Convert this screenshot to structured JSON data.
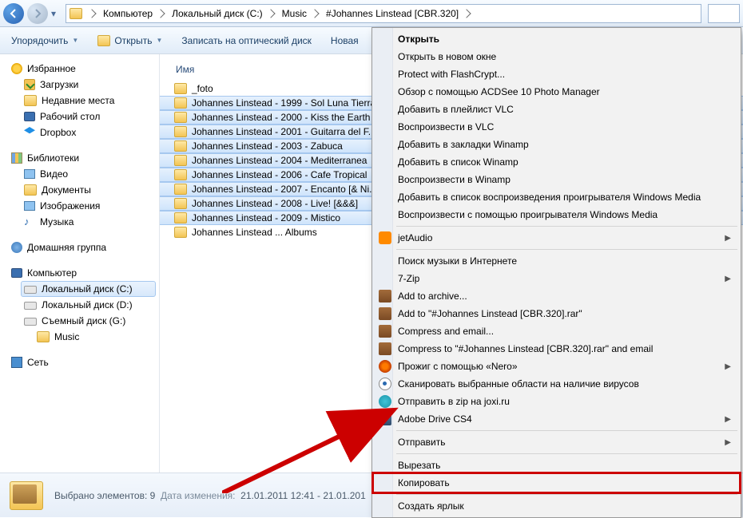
{
  "breadcrumbs": [
    "Компьютер",
    "Локальный диск (C:)",
    "Music",
    "#Johannes Linstead [CBR.320]"
  ],
  "toolbar": {
    "organize": "Упорядочить",
    "open": "Открыть",
    "burn": "Записать на оптический диск",
    "newfolder_truncated": "Новая"
  },
  "sidebar": {
    "favorites": "Избранное",
    "downloads": "Загрузки",
    "recent": "Недавние места",
    "desktop": "Рабочий стол",
    "dropbox": "Dropbox",
    "libraries": "Библиотеки",
    "video": "Видео",
    "documents": "Документы",
    "pictures": "Изображения",
    "music": "Музыка",
    "homegroup": "Домашняя группа",
    "computer": "Компьютер",
    "disk_c": "Локальный диск (C:)",
    "disk_d": "Локальный диск (D:)",
    "disk_g": "Съемный диск (G:)",
    "music_folder": "Music",
    "network": "Сеть"
  },
  "column_name": "Имя",
  "files": [
    {
      "name": "_foto",
      "sel": false
    },
    {
      "name": "Johannes Linstead - 1999 - Sol Luna Tierra",
      "sel": true
    },
    {
      "name": "Johannes Linstead - 2000 - Kiss the Earth",
      "sel": true
    },
    {
      "name": "Johannes Linstead - 2001 - Guitarra del F..",
      "sel": true
    },
    {
      "name": "Johannes Linstead - 2003 - Zabuca",
      "sel": true
    },
    {
      "name": "Johannes Linstead - 2004 - Mediterranea",
      "sel": true
    },
    {
      "name": "Johannes Linstead - 2006 - Cafe Tropical",
      "sel": true
    },
    {
      "name": "Johannes Linstead - 2007 - Encanto [& Ni..",
      "sel": true
    },
    {
      "name": "Johannes Linstead - 2008 - Live! [&&&]",
      "sel": true
    },
    {
      "name": "Johannes Linstead - 2009 - Mistico",
      "sel": true
    },
    {
      "name": "Johannes Linstead ... Albums",
      "sel": false
    }
  ],
  "context_menu": [
    {
      "label": "Открыть",
      "default": true
    },
    {
      "label": "Открыть в новом окне"
    },
    {
      "label": "Protect with FlashCrypt..."
    },
    {
      "label": "Обзор с помощью ACDSee 10 Photo Manager"
    },
    {
      "label": "Добавить в плейлист VLC"
    },
    {
      "label": "Воспроизвести в VLC"
    },
    {
      "label": "Добавить в закладки Winamp"
    },
    {
      "label": "Добавить в список Winamp"
    },
    {
      "label": "Воспроизвести в Winamp"
    },
    {
      "label": "Добавить в список воспроизведения проигрывателя Windows Media"
    },
    {
      "label": "Воспроизвести с помощью проигрывателя Windows Media"
    },
    {
      "sep": true
    },
    {
      "label": "jetAudio",
      "icon": "jet",
      "sub": true
    },
    {
      "sep": true
    },
    {
      "label": "Поиск музыки в Интернете"
    },
    {
      "label": "7-Zip",
      "sub": true
    },
    {
      "label": "Add to archive...",
      "icon": "winrar"
    },
    {
      "label": "Add to \"#Johannes Linstead [CBR.320].rar\"",
      "icon": "winrar"
    },
    {
      "label": "Compress and email...",
      "icon": "winrar"
    },
    {
      "label": "Compress to \"#Johannes Linstead [CBR.320].rar\" and email",
      "icon": "winrar"
    },
    {
      "label": "Прожиг с помощью «Nero»",
      "icon": "nero",
      "sub": true
    },
    {
      "label": "Сканировать выбранные области на наличие вирусов",
      "icon": "eye"
    },
    {
      "label": "Отправить в zip на joxi.ru",
      "icon": "joxi"
    },
    {
      "label": "Adobe Drive CS4",
      "icon": "adobe",
      "sub": true
    },
    {
      "sep": true
    },
    {
      "label": "Отправить",
      "sub": true
    },
    {
      "sep": true
    },
    {
      "label": "Вырезать"
    },
    {
      "label": "Копировать",
      "highlight": true
    },
    {
      "sep": true
    },
    {
      "label": "Создать ярлык"
    }
  ],
  "status": {
    "selection": "Выбрано элементов: 9",
    "modified_label": "Дата изменения:",
    "modified_value": "21.01.2011 12:41 - 21.01.201"
  }
}
